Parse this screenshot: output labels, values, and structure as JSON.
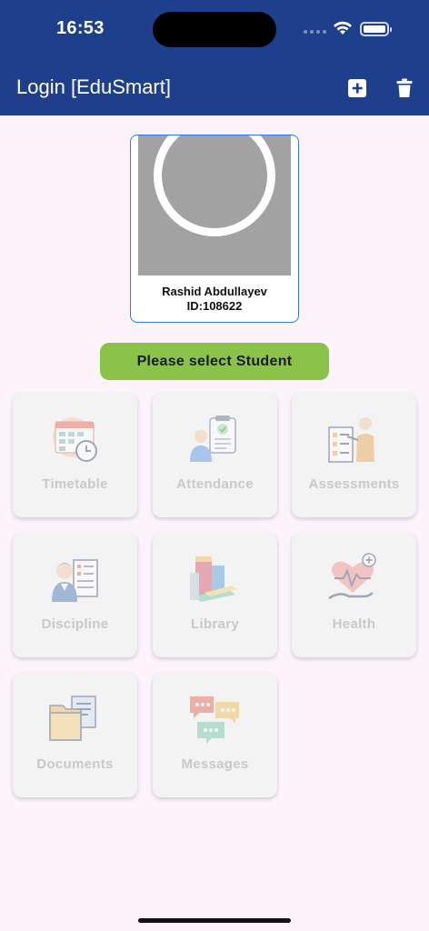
{
  "status_bar": {
    "time": "16:53"
  },
  "app_bar": {
    "title": "Login [EduSmart]",
    "actions": [
      {
        "icon": "add-square-icon"
      },
      {
        "icon": "trash-icon"
      }
    ]
  },
  "student": {
    "name": "Rashid Abdullayev",
    "id_text": "ID:108622"
  },
  "select_button": {
    "label": "Please select Student"
  },
  "modules": [
    {
      "label": "Timetable",
      "icon": "timetable-icon"
    },
    {
      "label": "Attendance",
      "icon": "attendance-icon"
    },
    {
      "label": "Assessments",
      "icon": "assessments-icon"
    },
    {
      "label": "Discipline",
      "icon": "discipline-icon"
    },
    {
      "label": "Library",
      "icon": "library-icon"
    },
    {
      "label": "Health",
      "icon": "health-icon"
    },
    {
      "label": "Documents",
      "icon": "documents-icon"
    },
    {
      "label": "Messages",
      "icon": "messages-icon"
    }
  ],
  "colors": {
    "primary": "#1e3f8c",
    "accent_green": "#8bc34a",
    "background": "#fdf4fb",
    "tile_background": "#f3f3f3",
    "tile_label_disabled": "#c9c9c9"
  }
}
